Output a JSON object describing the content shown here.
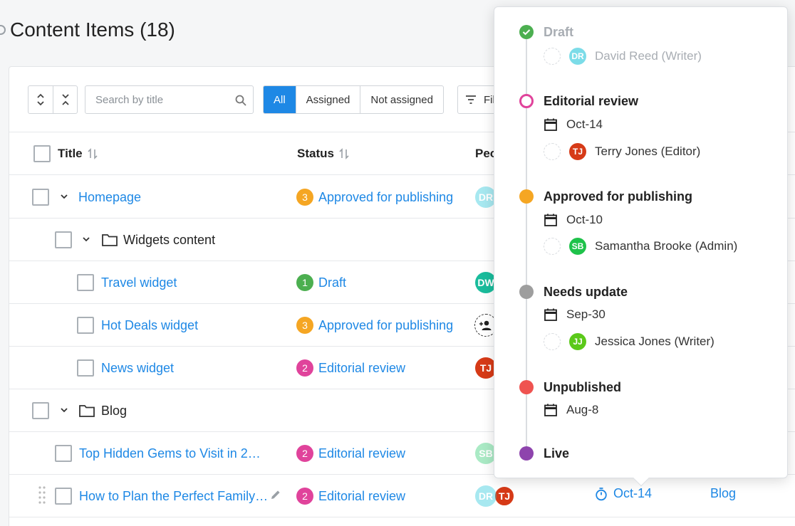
{
  "page": {
    "title": "Content Items (18)"
  },
  "toolbar": {
    "search_placeholder": "Search by title",
    "tabs": [
      "All",
      "Assigned",
      "Not assigned"
    ],
    "filter_label": "Fil"
  },
  "table": {
    "columns": [
      "Title",
      "Status",
      "Peo"
    ],
    "rows": [
      {
        "title": "Homepage",
        "type": "item",
        "status_step": "3",
        "status": "Approved for publishing",
        "status_color": "#f5a623",
        "people": [
          {
            "initials": "DR",
            "color": "#26c6da",
            "faded": true
          }
        ]
      },
      {
        "title": "Widgets content",
        "type": "folder"
      },
      {
        "title": "Travel widget",
        "type": "item",
        "status_step": "1",
        "status": "Draft",
        "status_color": "#4caf50",
        "people": [
          {
            "initials": "DW",
            "color": "#1abc9c",
            "faded": false
          }
        ]
      },
      {
        "title": "Hot Deals widget",
        "type": "item",
        "status_step": "3",
        "status": "Approved for publishing",
        "status_color": "#f5a623",
        "people": []
      },
      {
        "title": "News widget",
        "type": "item",
        "status_step": "2",
        "status": "Editorial review",
        "status_color": "#e0439b",
        "people": [
          {
            "initials": "TJ",
            "color": "#d63a17",
            "faded": false
          }
        ]
      },
      {
        "title": "Blog",
        "type": "folder"
      },
      {
        "title": "Top Hidden Gems to Visit in 2…",
        "type": "item",
        "status_step": "2",
        "status": "Editorial review",
        "status_color": "#e0439b",
        "people": [
          {
            "initials": "SB",
            "color": "#2ecc71",
            "faded": true
          }
        ]
      },
      {
        "title": "How to Plan the Perfect Family…",
        "type": "item",
        "status_step": "2",
        "status": "Editorial review",
        "status_color": "#e0439b",
        "people": [
          {
            "initials": "DR",
            "color": "#26c6da",
            "faded": true
          },
          {
            "initials": "TJ",
            "color": "#d63a17",
            "faded": false
          }
        ],
        "due": "Oct-14",
        "folder": "Blog"
      }
    ]
  },
  "workflow_popover": {
    "stages": [
      {
        "name": "Draft",
        "color": "#4caf50",
        "state": "done",
        "date": null,
        "person": {
          "initials": "DR",
          "color": "#26c6da",
          "name": "David Reed (Writer)"
        }
      },
      {
        "name": "Editorial review",
        "color": "#e0439b",
        "state": "current",
        "date": "Oct-14",
        "person": {
          "initials": "TJ",
          "color": "#d63a17",
          "name": "Terry Jones (Editor)"
        }
      },
      {
        "name": "Approved for publishing",
        "color": "#f5a623",
        "state": "upcoming",
        "date": "Oct-10",
        "person": {
          "initials": "SB",
          "color": "#1ec24a",
          "name": "Samantha Brooke (Admin)"
        }
      },
      {
        "name": "Needs update",
        "color": "#9e9e9e",
        "state": "upcoming",
        "date": "Sep-30",
        "person": {
          "initials": "JJ",
          "color": "#5bc91a",
          "name": "Jessica Jones (Writer)"
        }
      },
      {
        "name": "Unpublished",
        "color": "#ef5350",
        "state": "upcoming",
        "date": "Aug-8",
        "person": null
      },
      {
        "name": "Live",
        "color": "#8e44ad",
        "state": "upcoming",
        "date": null,
        "person": null
      }
    ]
  }
}
